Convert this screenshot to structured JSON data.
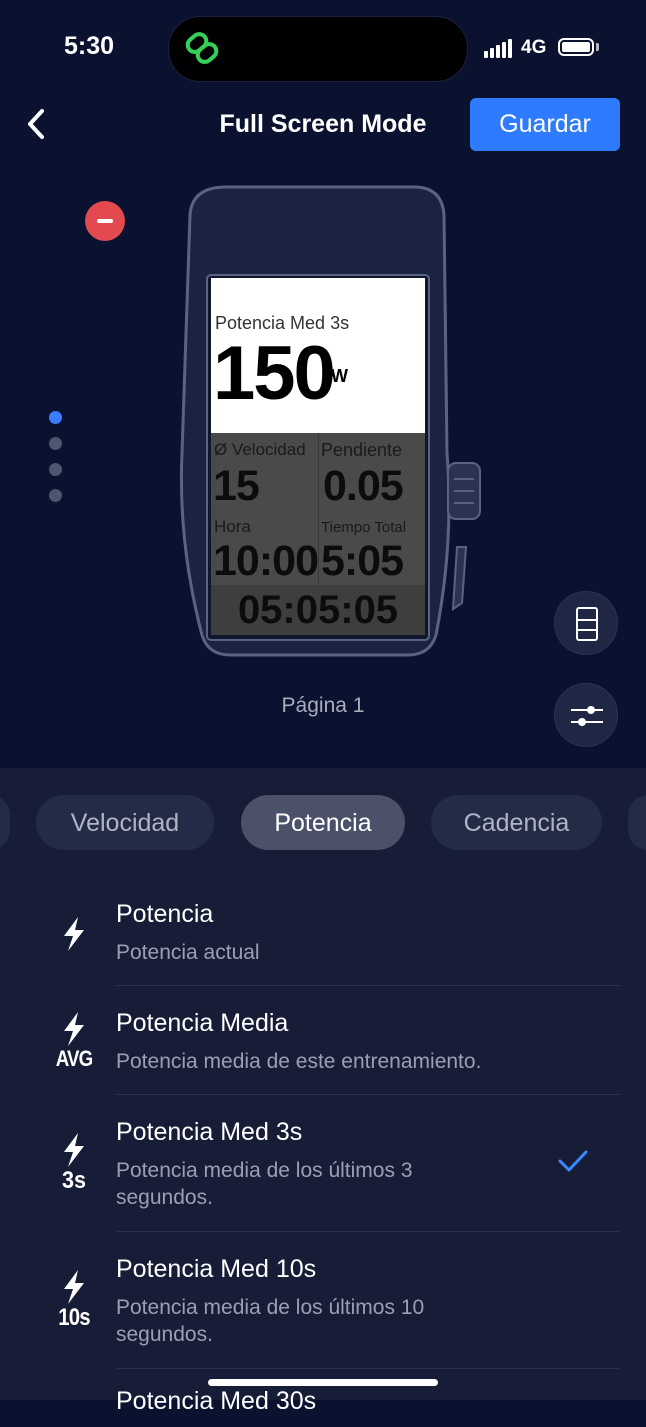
{
  "status": {
    "time": "5:30",
    "network": "4G"
  },
  "header": {
    "title": "Full Screen Mode",
    "save_label": "Guardar"
  },
  "device": {
    "main_label": "Potencia Med 3s",
    "main_value": "150",
    "main_unit": "W",
    "cells": [
      {
        "label": "Ø Velocidad",
        "value": "15"
      },
      {
        "label": "Pendiente",
        "value": "0.05"
      },
      {
        "label": "Hora",
        "value": "10:00"
      },
      {
        "label": "Tiempo Total",
        "value": "5:05"
      }
    ],
    "timer": "05:05:05"
  },
  "page_label": "Página 1",
  "tabs": [
    {
      "label": "Velocidad",
      "active": false
    },
    {
      "label": "Potencia",
      "active": true
    },
    {
      "label": "Cadencia",
      "active": false
    }
  ],
  "list": [
    {
      "title": "Potencia",
      "subtitle": "Potencia actual",
      "icon_tag": "",
      "selected": false
    },
    {
      "title": "Potencia Media",
      "subtitle": "Potencia media de este entrenamiento.",
      "icon_tag": "AVG",
      "selected": false
    },
    {
      "title": "Potencia Med 3s",
      "subtitle": "Potencia media de los últimos 3 segundos.",
      "icon_tag": "3s",
      "selected": true
    },
    {
      "title": "Potencia Med 10s",
      "subtitle": "Potencia media de los últimos 10 segundos.",
      "icon_tag": "10s",
      "selected": false
    },
    {
      "title": "Potencia Med 30s",
      "subtitle": "",
      "icon_tag": "",
      "selected": false
    }
  ],
  "colors": {
    "accent": "#2f7bff",
    "remove": "#e24a4f",
    "background": "#0b1230",
    "panel": "#171d37"
  }
}
